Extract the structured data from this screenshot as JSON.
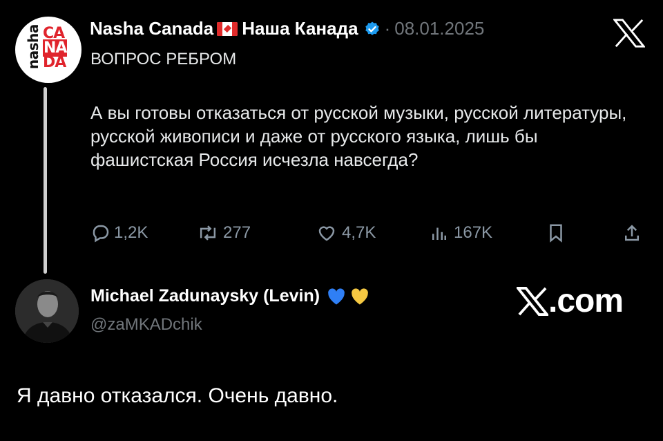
{
  "author": {
    "name": "Nasha Canada",
    "name_ru": "Наша Канада",
    "date": "08.01.2025",
    "avatar_text_1": "nasha",
    "avatar_text_2": "CANADA"
  },
  "post": {
    "headline": "ВОПРОС РЕБРОМ",
    "body": "А вы готовы отказаться от русской музыки, русской литературы, русской живописи и даже от русского языка, лишь бы фашистская Россия исчезла навсегда?"
  },
  "actions": {
    "replies": "1,2K",
    "reposts": "277",
    "likes": "4,7K",
    "views": "167K"
  },
  "reply_author": {
    "name": "Michael Zadunaysky (Levin)",
    "handle": "@zaMKADchik"
  },
  "watermark": {
    "text": ".com"
  },
  "reply": {
    "text": "Я давно отказался. Очень давно."
  },
  "colors": {
    "background": "#000000",
    "muted": "#71767b",
    "verified": "#1d9bf0",
    "flag_red": "#e02b2b"
  },
  "icons": [
    "x-logo-icon",
    "verified-badge-icon",
    "canada-flag-icon",
    "reply-icon",
    "repost-icon",
    "like-icon",
    "views-icon",
    "bookmark-icon",
    "share-icon",
    "blue-heart-icon",
    "yellow-heart-icon"
  ]
}
